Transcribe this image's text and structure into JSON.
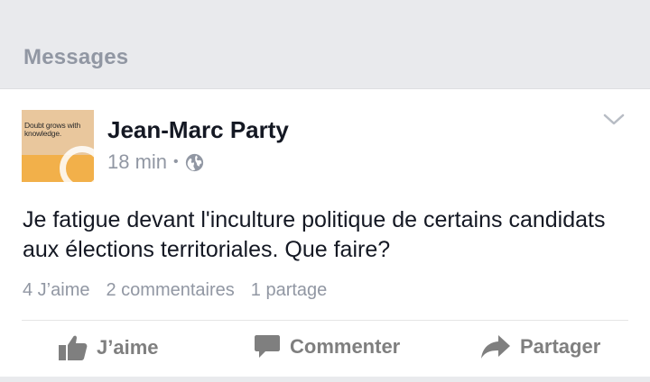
{
  "header": {
    "title": "Messages"
  },
  "post": {
    "author": "Jean-Marc Party",
    "avatar_text": "Doubt grows with knowledge.",
    "time": "18 min",
    "separator": "•",
    "privacy_icon": "globe-icon",
    "options_icon": "chevron-down-icon",
    "text": "Je fatigue devant l'inculture politique de certains candidats aux élections territoriales. Que faire?",
    "stats": {
      "likes": "4 J’aime",
      "comments": "2 commentaires",
      "shares": "1 partage"
    },
    "actions": {
      "like": "J’aime",
      "comment": "Commenter",
      "share": "Partager"
    }
  },
  "colors": {
    "header_bg": "#e9eaed",
    "header_text": "#9197a3",
    "name_text": "#141823",
    "meta_text": "#9197a3",
    "action_text": "#7f7f7f"
  }
}
